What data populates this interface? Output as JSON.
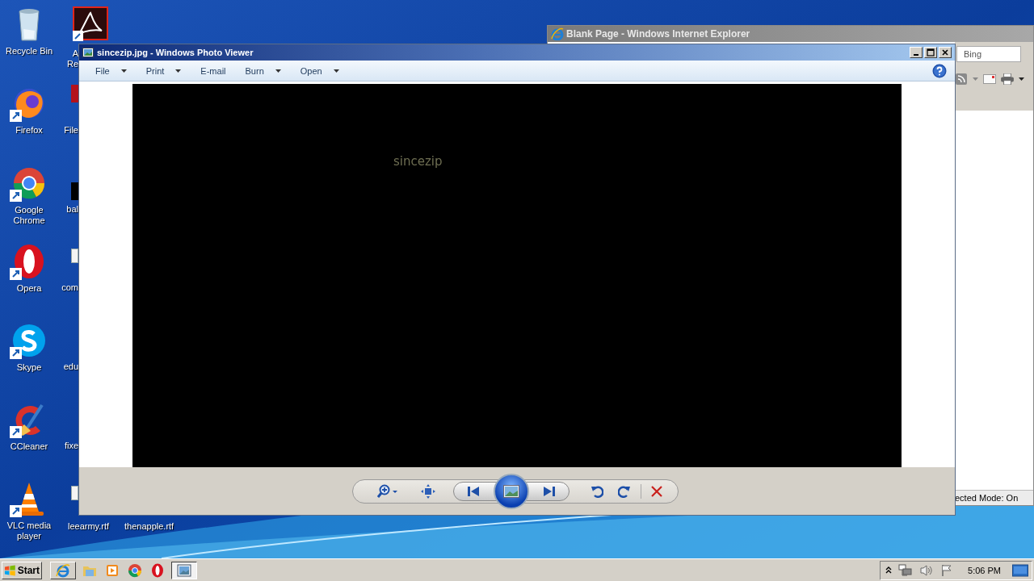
{
  "desktop_icons": [
    {
      "label": "Recycle Bin"
    },
    {
      "label": "Firefox"
    },
    {
      "label": "Google Chrome"
    },
    {
      "label": "Opera"
    },
    {
      "label": "Skype"
    },
    {
      "label": "CCleaner"
    },
    {
      "label": "VLC media player"
    }
  ],
  "partial_icons": [
    {
      "label": "A Re"
    },
    {
      "label": "File"
    },
    {
      "label": "bal"
    },
    {
      "label": "com"
    },
    {
      "label": "edu"
    },
    {
      "label": "fixe"
    }
  ],
  "bottom_files": [
    {
      "label": "leearmy.rtf"
    },
    {
      "label": "thenapple.rtf"
    }
  ],
  "background_window": {
    "title": "Blank Page - Windows Internet Explorer",
    "search_placeholder": "Bing",
    "status": "ected Mode: On"
  },
  "photo_viewer": {
    "title": "sincezip.jpg - Windows Photo Viewer",
    "menu": [
      {
        "label": "File",
        "dropdown": true
      },
      {
        "label": "Print",
        "dropdown": true
      },
      {
        "label": "E-mail",
        "dropdown": false
      },
      {
        "label": "Burn",
        "dropdown": true
      },
      {
        "label": "Open",
        "dropdown": true
      }
    ],
    "image_text": "sincezip"
  },
  "taskbar": {
    "start": "Start",
    "items": [
      {
        "kind": "window",
        "selected": false
      },
      {
        "kind": "launcher",
        "selected": false
      },
      {
        "kind": "launcher",
        "selected": false
      },
      {
        "kind": "launcher",
        "selected": false
      },
      {
        "kind": "launcher",
        "selected": false
      },
      {
        "kind": "window",
        "selected": true
      }
    ],
    "clock": "5:06 PM"
  }
}
